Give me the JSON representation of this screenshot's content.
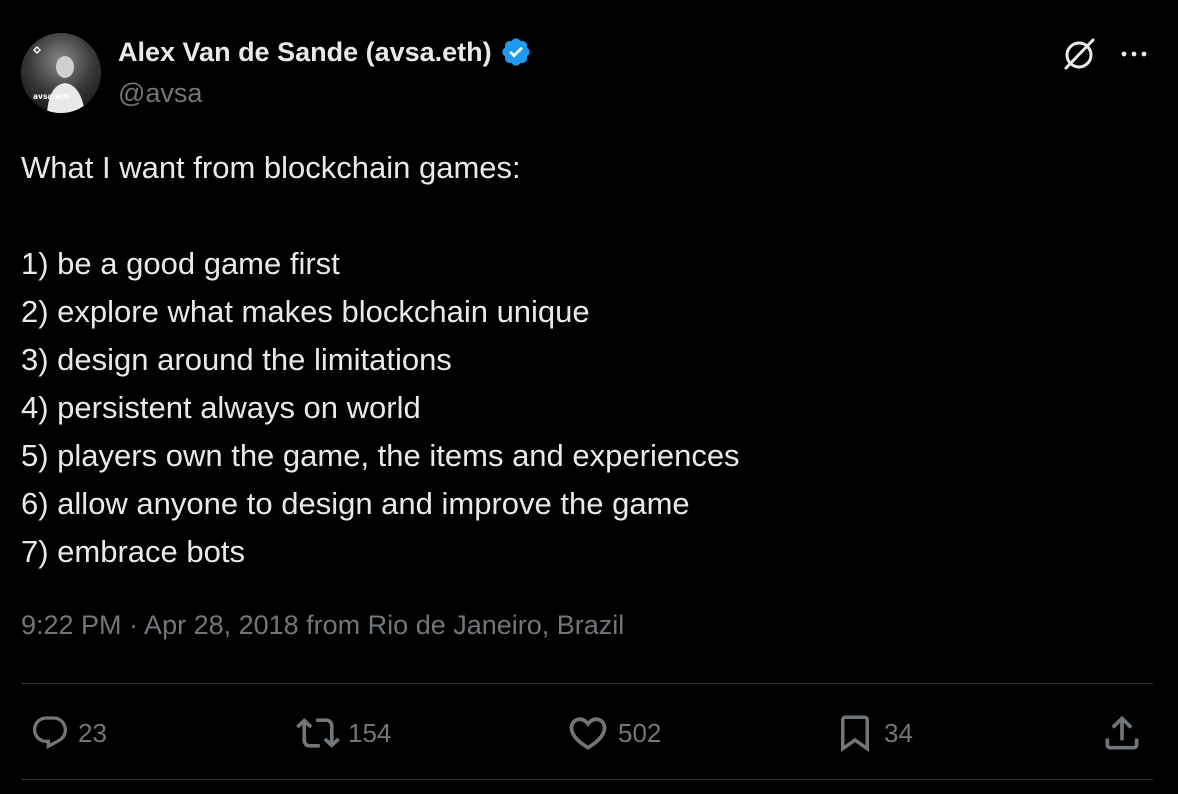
{
  "author": {
    "name": "Alex Van de Sande (avsa.eth)",
    "handle": "@avsa",
    "avatar_text": "avsa.eth",
    "verified": true
  },
  "tweet": {
    "text": "What I want from blockchain games:\n\n1) be a good game first\n2) explore what makes blockchain unique\n3) design around the limitations\n4) persistent always on world\n5) players own the game, the items and experiences\n6) allow anyone to design and improve the game\n7) embrace bots",
    "timestamp": "9:22 PM · Apr 28, 2018 from Rio de Janeiro, Brazil"
  },
  "actions": {
    "replies": "23",
    "reposts": "154",
    "likes": "502",
    "bookmarks": "34"
  },
  "icons": {
    "verified": "verified-badge-icon",
    "grok": "grok-icon",
    "more": "more-options-icon",
    "reply": "reply-icon",
    "repost": "repost-icon",
    "like": "heart-icon",
    "bookmark": "bookmark-icon",
    "share": "share-icon"
  },
  "colors": {
    "background": "#000000",
    "text_primary": "#e7e9ea",
    "text_secondary": "#71767b",
    "verified_blue": "#1d9bf0",
    "divider": "#2f3336"
  }
}
